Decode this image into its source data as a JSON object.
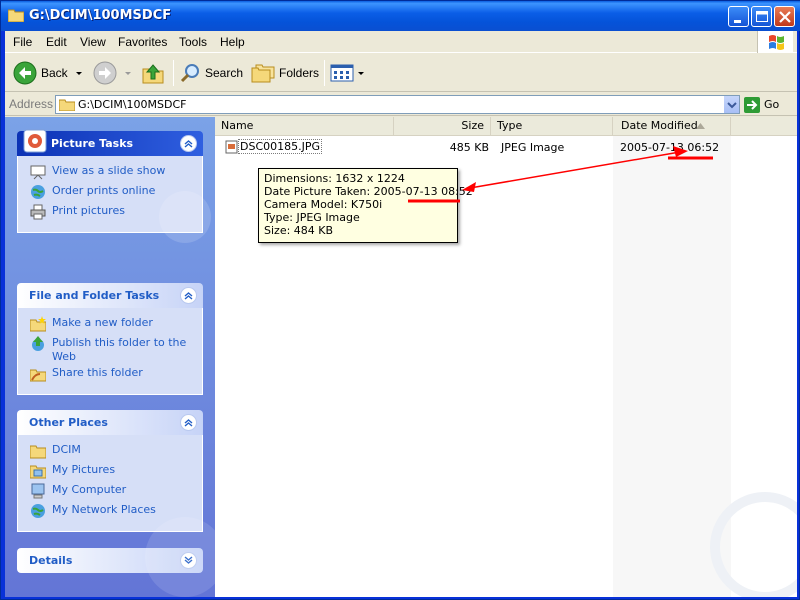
{
  "window": {
    "title": "G:\\DCIM\\100MSDCF"
  },
  "menu": [
    "File",
    "Edit",
    "View",
    "Favorites",
    "Tools",
    "Help"
  ],
  "toolbar": {
    "back": "Back",
    "search": "Search",
    "folders": "Folders"
  },
  "address": {
    "label": "Address",
    "value": "G:\\DCIM\\100MSDCF",
    "go": "Go"
  },
  "taskpane": {
    "picture_tasks": {
      "title": "Picture Tasks",
      "items": [
        "View as a slide show",
        "Order prints online",
        "Print pictures"
      ]
    },
    "file_folder_tasks": {
      "title": "File and Folder Tasks",
      "items": [
        "Make a new folder",
        "Publish this folder to the Web",
        "Share this folder"
      ]
    },
    "other_places": {
      "title": "Other Places",
      "items": [
        "DCIM",
        "My Pictures",
        "My Computer",
        "My Network Places"
      ]
    },
    "details": {
      "title": "Details"
    }
  },
  "columns": {
    "name": "Name",
    "size": "Size",
    "type": "Type",
    "date_modified": "Date Modified"
  },
  "files": [
    {
      "name": "DSC00185.JPG",
      "size": "485 KB",
      "type": "JPEG Image",
      "date_modified": "2005-07-13 06:52"
    }
  ],
  "tooltip": {
    "dimensions": "Dimensions: 1632 x 1224",
    "date_taken": "Date Picture Taken: 2005-07-13 08:52",
    "camera": "Camera Model: K750i",
    "type": "Type: JPEG Image",
    "size": "Size: 484 KB"
  },
  "colors": {
    "annotation": "#ff0000",
    "link": "#215dc6",
    "titlebar": "#0a5fe0"
  }
}
